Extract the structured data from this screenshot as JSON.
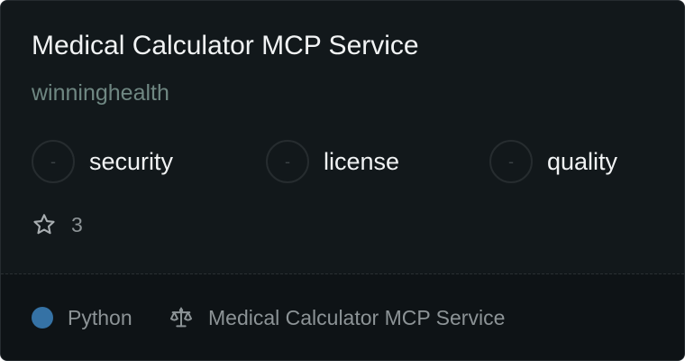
{
  "card": {
    "title": "Medical Calculator MCP Service",
    "owner": "winninghealth",
    "badges": [
      {
        "symbol": "-",
        "label": "security"
      },
      {
        "symbol": "-",
        "label": "license"
      },
      {
        "symbol": "-",
        "label": "quality"
      }
    ],
    "stars": {
      "icon": "star-outline-icon",
      "count": "3"
    },
    "footer": {
      "language": {
        "label": "Python",
        "color": "#3572a5"
      },
      "license": {
        "icon": "scale-icon",
        "label": "Medical Calculator MCP Service"
      }
    }
  },
  "colors": {
    "background": "#12181b",
    "footer_background": "#0e1316",
    "title": "#f1f3f4",
    "owner": "#6f8782",
    "muted": "#8c9396"
  }
}
